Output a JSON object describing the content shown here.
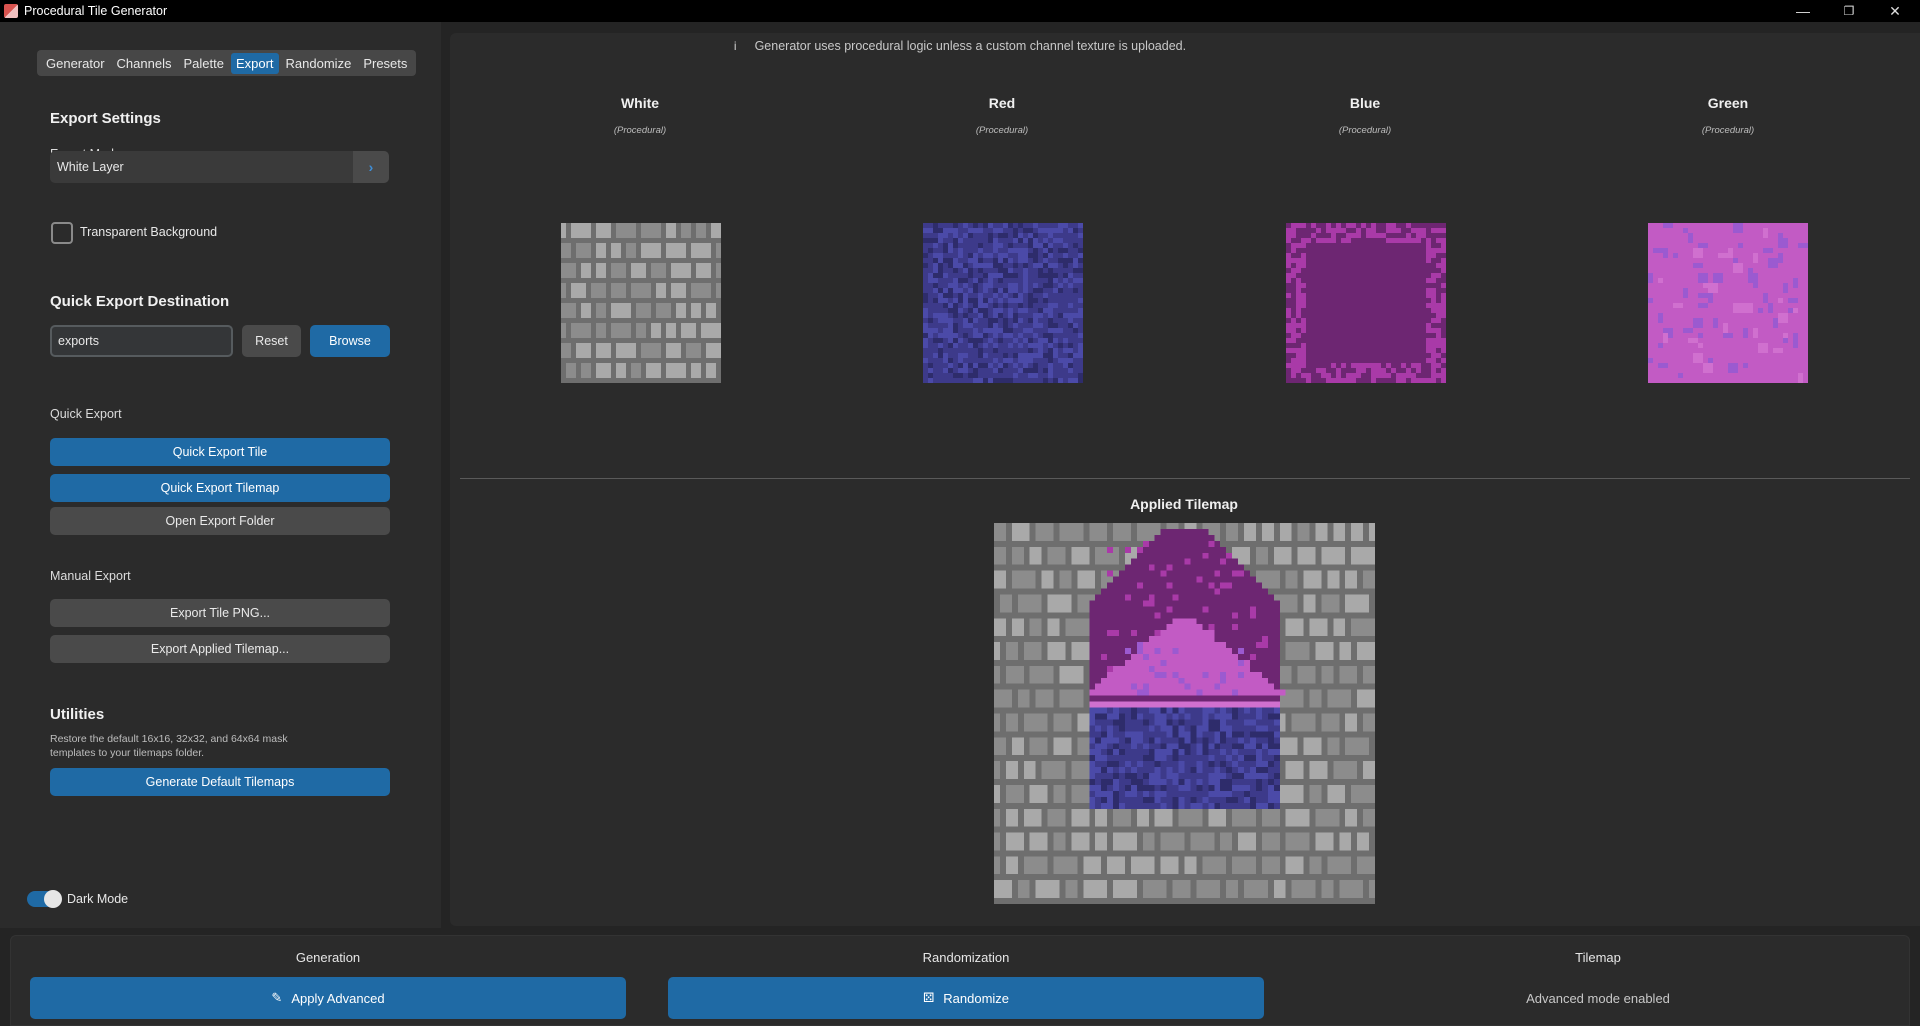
{
  "window": {
    "title": "Procedural Tile Generator",
    "minimize": "—",
    "maximize": "❐",
    "close": "✕"
  },
  "tabs": [
    "Generator",
    "Channels",
    "Palette",
    "Export",
    "Randomize",
    "Presets"
  ],
  "active_tab": "Export",
  "export_settings": {
    "heading": "Export Settings",
    "mode_label": "Export Mode",
    "mode_value": "White Layer",
    "transparent_label": "Transparent Background",
    "transparent_checked": false
  },
  "quick_dest": {
    "heading": "Quick Export Destination",
    "path_value": "exports",
    "reset_label": "Reset",
    "browse_label": "Browse"
  },
  "quick_export": {
    "heading": "Quick Export",
    "tile_label": "Quick Export Tile",
    "tilemap_label": "Quick Export Tilemap",
    "folder_label": "Open Export Folder"
  },
  "manual_export": {
    "heading": "Manual Export",
    "png_label": "Export Tile PNG...",
    "applied_label": "Export Applied Tilemap..."
  },
  "utilities": {
    "heading": "Utilities",
    "note_line1": "Restore the default 16x16, 32x32, and 64x64 mask",
    "note_line2": "templates to your tilemaps folder.",
    "generate_label": "Generate Default Tilemaps"
  },
  "dark_mode": {
    "label": "Dark Mode",
    "enabled": true
  },
  "info_text": "Generator uses procedural logic unless a custom channel texture is uploaded.",
  "channels": [
    {
      "name": "White",
      "source": "(Procedural)",
      "base": "#8c8c8c",
      "light": "#a9a9a9",
      "dark": "#6e6e6e"
    },
    {
      "name": "Red",
      "source": "(Procedural)",
      "base": "#3d3a8a",
      "light": "#4b4aa8",
      "dark": "#2e2c6b"
    },
    {
      "name": "Blue",
      "source": "(Procedural)",
      "base": "#6d2672",
      "light": "#a93aa8",
      "dark": "#5a1f60"
    },
    {
      "name": "Green",
      "source": "(Procedural)",
      "base": "#c25bc4",
      "light": "#9b5ad0",
      "dark": "#d070cf"
    }
  ],
  "applied_tilemap": {
    "title": "Applied Tilemap"
  },
  "bottom": {
    "generation_title": "Generation",
    "apply_label": "Apply Advanced",
    "randomization_title": "Randomization",
    "randomize_label": "Randomize",
    "tilemap_title": "Tilemap",
    "tilemap_status": "Advanced mode enabled"
  }
}
